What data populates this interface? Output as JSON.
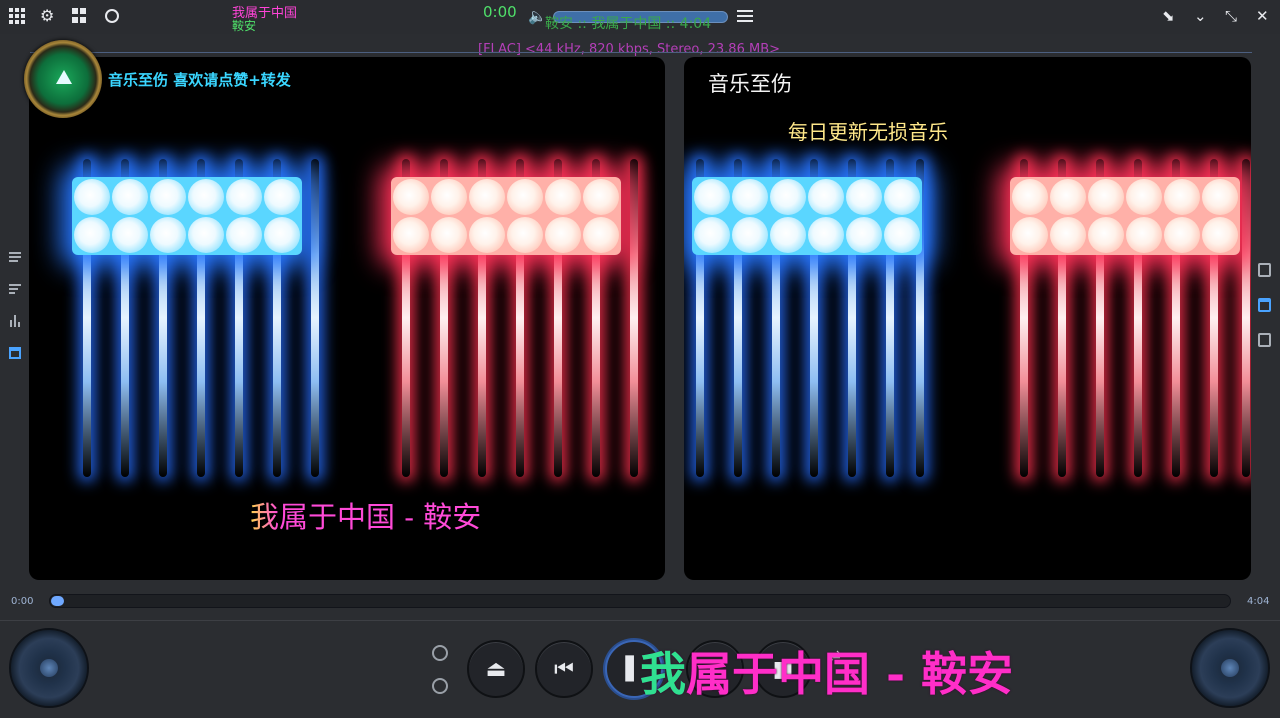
{
  "topbar": {
    "song_title": "我属于中国",
    "song_artist": "鞍安",
    "time_elapsed": "0:00",
    "marquee": "鞍安 :: 我属于中国 :: 4:04",
    "icons": [
      "grid-menu-icon",
      "gear-icon",
      "layout-icon",
      "palette-icon",
      "volume-icon",
      "equalizer-icon",
      "pin-icon",
      "chevron-down-icon",
      "shrink-icon",
      "close-icon"
    ],
    "glyphs": {
      "volume": "🔈",
      "pin": "⬊",
      "chevron": "⌄",
      "shrink": "⤡",
      "close": "✕",
      "gear": "⚙"
    }
  },
  "format_line": "[FLAC] <44 kHz, 820 kbps, Stereo, 23.86 MB>",
  "video": {
    "channel_caption": "音乐至伤 喜欢请点赞+转发",
    "left_title": "我属于中国 - 鞍安",
    "right_brand": "音乐至伤",
    "right_sub": "每日更新无损音乐"
  },
  "progress": {
    "current": "0:00",
    "total": "4:04",
    "fraction": 0.0
  },
  "controls": {
    "eject_glyph": "⏏",
    "prev_glyph": "⏮",
    "play_glyph": "▌",
    "stop_glyph": "■",
    "repeat_glyph": "⇄"
  },
  "lyric_overlay": {
    "highlight": "我",
    "rest": "属于中国 - 鞍安"
  },
  "colors": {
    "accent_blue": "#3a66b6",
    "title_magenta": "#ff44d8",
    "artist_green": "#4fe06a",
    "caption_cyan": "#3ad6ff"
  }
}
